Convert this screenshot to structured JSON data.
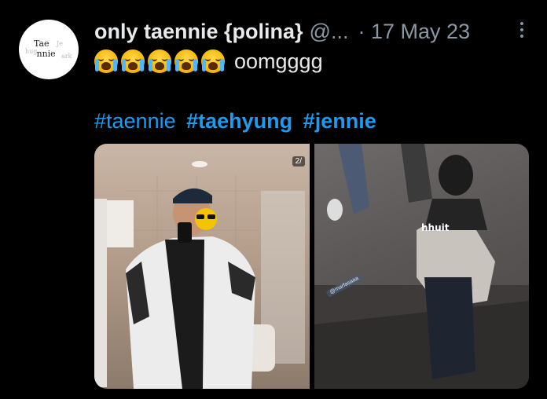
{
  "author": {
    "avatar_logo_main": "Tae\nnnie",
    "avatar_logo_faint_a": "hug",
    "avatar_logo_faint_b": "Je",
    "avatar_logo_faint_c": "ark",
    "display_name": "only taennie {polina}",
    "handle": "@...",
    "date": "· 17 May 23"
  },
  "tweet": {
    "emoji_count": 5,
    "emoji_name": "loudly-crying-face",
    "text": "oomgggg",
    "hashtags": [
      {
        "text": "#taennie",
        "bold": false
      },
      {
        "text": "#taehyung",
        "bold": true
      },
      {
        "text": "#jennie",
        "bold": true
      }
    ]
  },
  "media": {
    "photos": [
      {
        "name": "mirror-selfie-photo",
        "counter": "2/"
      },
      {
        "name": "street-photo",
        "caption": "hhuit",
        "stamp": "@marfasaaa"
      }
    ]
  },
  "colors": {
    "background": "#000000",
    "text_primary": "#e7e9ea",
    "text_secondary": "#8b98a5",
    "hashtag": "#1d9bf0"
  }
}
